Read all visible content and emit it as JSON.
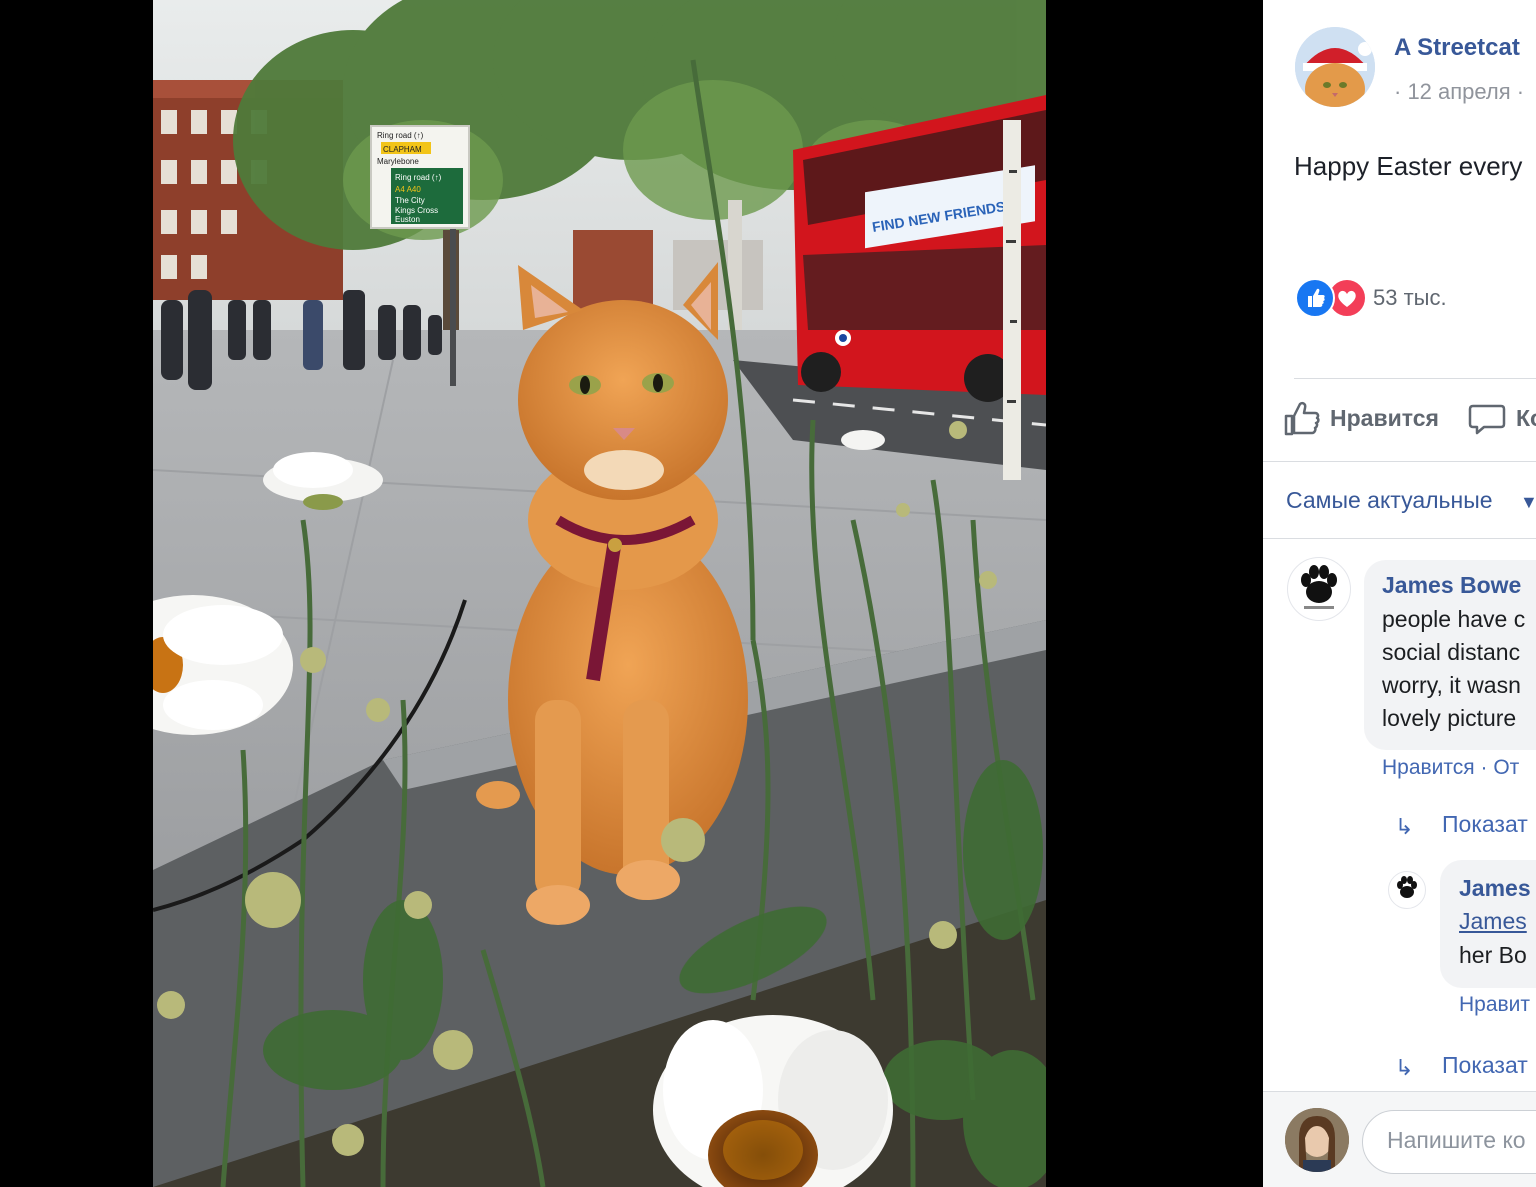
{
  "post": {
    "page_name": "A Streetcat",
    "date": "· 12 апреля ·",
    "text": "Happy Easter every",
    "reactions_count": "53 тыс.",
    "actions": {
      "like": "Нравится",
      "comment": "Ко"
    },
    "sort_label": "Самые актуальные",
    "sort_caret": "▼"
  },
  "photo": {
    "sign_lines": [
      "Ring road (↑)",
      "CLAPHAM",
      "Marylebone",
      "Ring road (↑)",
      "A4 A40",
      "The City",
      "Kings Cross",
      "Euston"
    ],
    "bus_banner": "FIND NEW FRIENDS"
  },
  "comments": [
    {
      "author": "James Bowe",
      "lines": [
        "people have c",
        "social distanc",
        "worry, it wasn",
        "lovely picture"
      ],
      "actions": "Нравится · От",
      "view_replies": "Показат"
    },
    {
      "author": "James",
      "link": "James",
      "lines": [
        "her Bo"
      ],
      "actions": "Нравит",
      "view_replies": "Показат"
    }
  ],
  "composer": {
    "placeholder": "Напишите ко"
  },
  "icons": {
    "reaction_like": "thumbs-up-icon",
    "reaction_love": "heart-icon",
    "like_action": "thumbs-up-outline-icon",
    "comment_action": "speech-bubble-icon",
    "reply_arrow": "reply-arrow-icon"
  },
  "colors": {
    "link": "#385898",
    "like_blue": "#1877f2",
    "love_red": "#f33e58",
    "bus_red": "#d2151d",
    "cat_orange": "#d98a3a"
  }
}
